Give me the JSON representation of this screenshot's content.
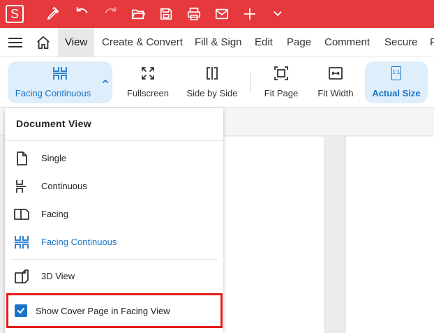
{
  "app": {
    "logo_letter": "S"
  },
  "titlebar_icons": [
    {
      "name": "pen-icon"
    },
    {
      "name": "undo-icon"
    },
    {
      "name": "redo-icon"
    },
    {
      "name": "open-folder-icon"
    },
    {
      "name": "save-icon"
    },
    {
      "name": "print-icon"
    },
    {
      "name": "mail-icon"
    },
    {
      "name": "plus-icon"
    },
    {
      "name": "chevron-down-icon"
    }
  ],
  "menu": {
    "items": [
      "View",
      "Create & Convert",
      "Fill & Sign",
      "Edit",
      "Page",
      "Comment",
      "Secure",
      "F"
    ],
    "active": "View"
  },
  "ribbon": {
    "facing_continuous": "Facing Continuous",
    "fullscreen": "Fullscreen",
    "side_by_side": "Side by Side",
    "fit_page": "Fit Page",
    "fit_width": "Fit Width",
    "actual_size": "Actual Size",
    "actual_size_glyph": "1:1"
  },
  "dropdown": {
    "title": "Document View",
    "items": [
      "Single",
      "Continuous",
      "Facing",
      "Facing Continuous",
      "3D View"
    ],
    "selected": "Facing Continuous",
    "cover_page_label": "Show Cover Page in Facing View",
    "cover_page_checked": true
  },
  "colors": {
    "brand": "#e5393d",
    "accent": "#1a73c8",
    "highlight": "#e51b1b"
  }
}
